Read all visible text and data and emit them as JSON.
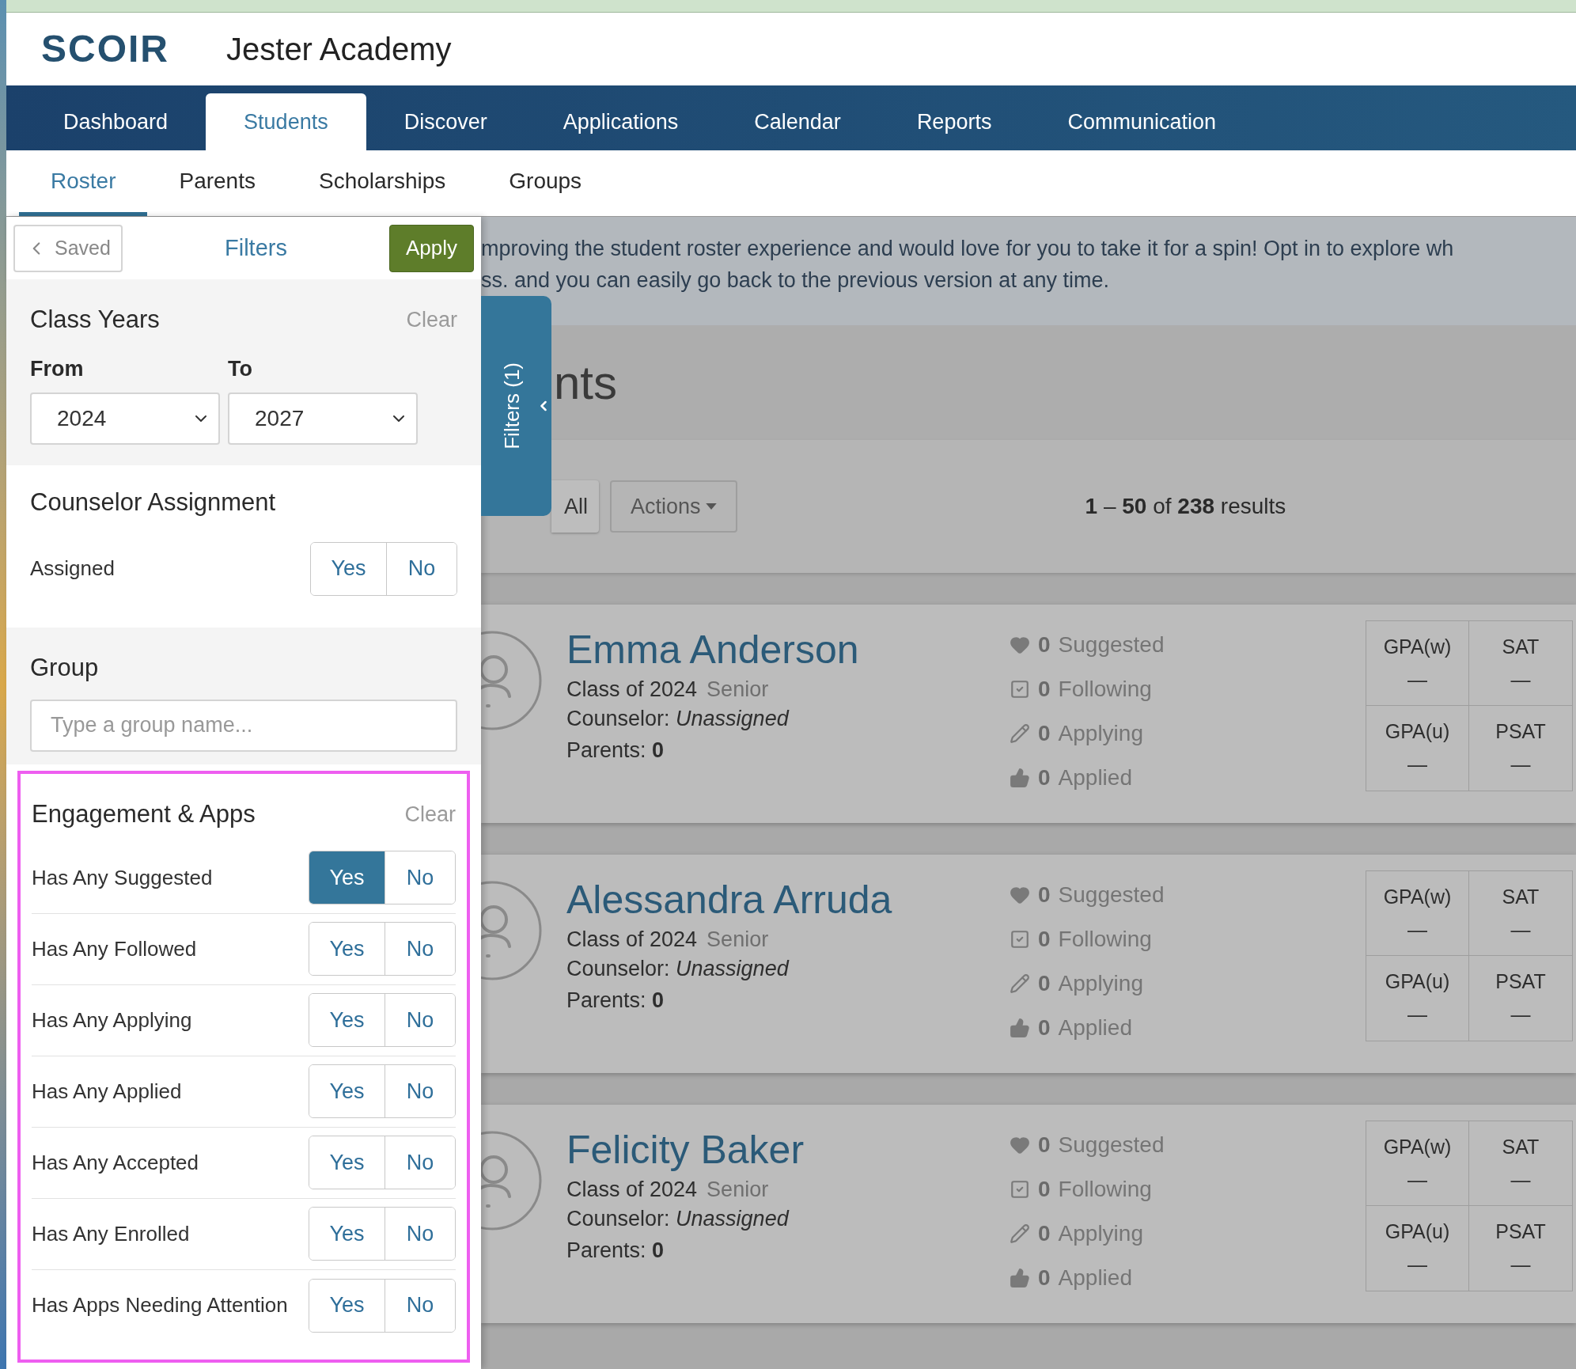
{
  "app": {
    "logo": "SCOIR",
    "school": "Jester Academy"
  },
  "nav": [
    {
      "label": "Dashboard",
      "selected": false
    },
    {
      "label": "Students",
      "selected": true
    },
    {
      "label": "Discover",
      "selected": false
    },
    {
      "label": "Applications",
      "selected": false
    },
    {
      "label": "Calendar",
      "selected": false
    },
    {
      "label": "Reports",
      "selected": false
    },
    {
      "label": "Communication",
      "selected": false
    }
  ],
  "subnav": [
    {
      "label": "Roster",
      "selected": true
    },
    {
      "label": "Parents",
      "selected": false
    },
    {
      "label": "Scholarships",
      "selected": false
    },
    {
      "label": "Groups",
      "selected": false
    }
  ],
  "filters_panel": {
    "saved_button": "Saved",
    "title": "Filters",
    "apply_button": "Apply",
    "class_years": {
      "title": "Class Years",
      "clear": "Clear",
      "from": {
        "label": "From",
        "value": "2024"
      },
      "to": {
        "label": "To",
        "value": "2027"
      }
    },
    "counselor_assignment": {
      "title": "Counselor Assignment",
      "rows": [
        {
          "label": "Assigned",
          "options": [
            {
              "label": "Yes",
              "selected": false
            },
            {
              "label": "No",
              "selected": false
            }
          ]
        }
      ]
    },
    "group": {
      "title": "Group",
      "placeholder": "Type a group name..."
    },
    "engagement": {
      "title": "Engagement & Apps",
      "clear": "Clear",
      "highlighted": true,
      "rows": [
        {
          "label": "Has Any Suggested",
          "options": [
            {
              "label": "Yes",
              "selected": true
            },
            {
              "label": "No",
              "selected": false
            }
          ]
        },
        {
          "label": "Has Any Followed",
          "options": [
            {
              "label": "Yes",
              "selected": false
            },
            {
              "label": "No",
              "selected": false
            }
          ]
        },
        {
          "label": "Has Any Applying",
          "options": [
            {
              "label": "Yes",
              "selected": false
            },
            {
              "label": "No",
              "selected": false
            }
          ]
        },
        {
          "label": "Has Any Applied",
          "options": [
            {
              "label": "Yes",
              "selected": false
            },
            {
              "label": "No",
              "selected": false
            }
          ]
        },
        {
          "label": "Has Any Accepted",
          "options": [
            {
              "label": "Yes",
              "selected": false
            },
            {
              "label": "No",
              "selected": false
            }
          ]
        },
        {
          "label": "Has Any Enrolled",
          "options": [
            {
              "label": "Yes",
              "selected": false
            },
            {
              "label": "No",
              "selected": false
            }
          ]
        },
        {
          "label": "Has Apps Needing Attention",
          "options": [
            {
              "label": "Yes",
              "selected": false
            },
            {
              "label": "No",
              "selected": false
            }
          ]
        }
      ]
    }
  },
  "filters_tab": {
    "label": "Filters (1)"
  },
  "banner": [
    "mproving the student roster experience and would love for you to take it for a spin! Opt in to explore wh",
    "ss. and you can easily go back to the previous version at any time."
  ],
  "page_heading": "nts",
  "toolbar": {
    "select_all": "All",
    "actions": "Actions",
    "results": "**1** – **50** of **238** results"
  },
  "students": [
    {
      "name": "Emma Anderson",
      "class_year": "Class of 2024",
      "grade": "Senior",
      "counselor": "Counselor: *Unassigned*",
      "parents": "Parents: **0**",
      "stats": [
        {
          "kind": "suggested",
          "count": "0",
          "label": "Suggested"
        },
        {
          "kind": "following",
          "count": "0",
          "label": "Following"
        },
        {
          "kind": "applying",
          "count": "0",
          "label": "Applying"
        },
        {
          "kind": "applied",
          "count": "0",
          "label": "Applied"
        }
      ],
      "scores": [
        {
          "label": "GPA(w)",
          "value": "—"
        },
        {
          "label": "SAT",
          "value": "—"
        },
        {
          "label": "GPA(u)",
          "value": "—"
        },
        {
          "label": "PSAT",
          "value": "—"
        }
      ]
    },
    {
      "name": "Alessandra Arruda",
      "class_year": "Class of 2024",
      "grade": "Senior",
      "counselor": "Counselor: *Unassigned*",
      "parents": "Parents: **0**",
      "stats": [
        {
          "kind": "suggested",
          "count": "0",
          "label": "Suggested"
        },
        {
          "kind": "following",
          "count": "0",
          "label": "Following"
        },
        {
          "kind": "applying",
          "count": "0",
          "label": "Applying"
        },
        {
          "kind": "applied",
          "count": "0",
          "label": "Applied"
        }
      ],
      "scores": [
        {
          "label": "GPA(w)",
          "value": "—"
        },
        {
          "label": "SAT",
          "value": "—"
        },
        {
          "label": "GPA(u)",
          "value": "—"
        },
        {
          "label": "PSAT",
          "value": "—"
        }
      ]
    },
    {
      "name": "Felicity Baker",
      "class_year": "Class of 2024",
      "grade": "Senior",
      "counselor": "Counselor: *Unassigned*",
      "parents": "Parents: **0**",
      "stats": [
        {
          "kind": "suggested",
          "count": "0",
          "label": "Suggested"
        },
        {
          "kind": "following",
          "count": "0",
          "label": "Following"
        },
        {
          "kind": "applying",
          "count": "0",
          "label": "Applying"
        },
        {
          "kind": "applied",
          "count": "0",
          "label": "Applied"
        }
      ],
      "scores": [
        {
          "label": "GPA(w)",
          "value": "—"
        },
        {
          "label": "SAT",
          "value": "—"
        },
        {
          "label": "GPA(u)",
          "value": "—"
        },
        {
          "label": "PSAT",
          "value": "—"
        }
      ]
    }
  ]
}
